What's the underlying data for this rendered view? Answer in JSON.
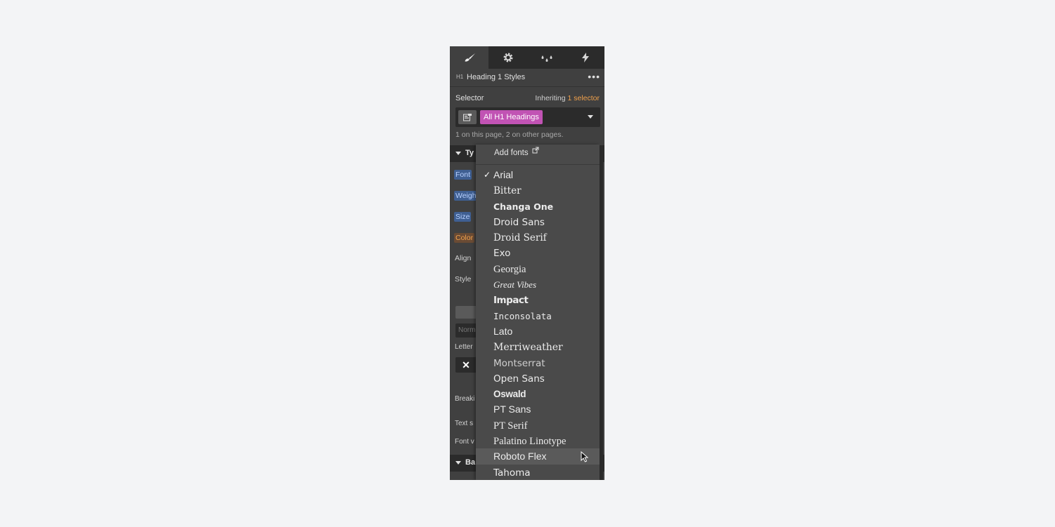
{
  "panel": {
    "tabs": [
      {
        "name": "style-tab",
        "icon": "brush-icon",
        "active": true
      },
      {
        "name": "settings-tab",
        "icon": "gear-icon",
        "active": false
      },
      {
        "name": "style-manager-tab",
        "icon": "droplets-icon",
        "active": false
      },
      {
        "name": "interactions-tab",
        "icon": "lightning-icon",
        "active": false
      }
    ],
    "header": {
      "tag": "H1",
      "title": "Heading 1 Styles",
      "more": "•••"
    },
    "selector": {
      "label": "Selector",
      "inheriting_prefix": "Inheriting ",
      "inheriting_link": "1 selector",
      "chip": "All H1 Headings",
      "note": "1 on this page, 2 on other pages."
    },
    "typography_section": {
      "label": "Ty"
    },
    "properties": {
      "font": "Font",
      "weight": "Weigh",
      "size": "Size",
      "color": "Color",
      "align": "Align",
      "style": "Style",
      "norm_placeholder": "Norm",
      "letter": "Letter",
      "x_button": "✕",
      "breaking": "Breaki",
      "text_s": "Text s",
      "font_v": "Font v"
    },
    "background_section": {
      "label": "Ba"
    },
    "accent": "#c153b4",
    "link_color": "#f0a04b"
  },
  "dropdown": {
    "add_fonts": "Add fonts",
    "selected": "Arial",
    "hovered": "Roboto Flex",
    "fonts": [
      "Arial",
      "Bitter",
      "Changa One",
      "Droid Sans",
      "Droid Serif",
      "Exo",
      "Georgia",
      "Great Vibes",
      "Impact",
      "Inconsolata",
      "Lato",
      "Merriweather",
      "Montserrat",
      "Open Sans",
      "Oswald",
      "PT Sans",
      "PT Serif",
      "Palatino Linotype",
      "Roboto Flex",
      "Tahoma"
    ]
  }
}
